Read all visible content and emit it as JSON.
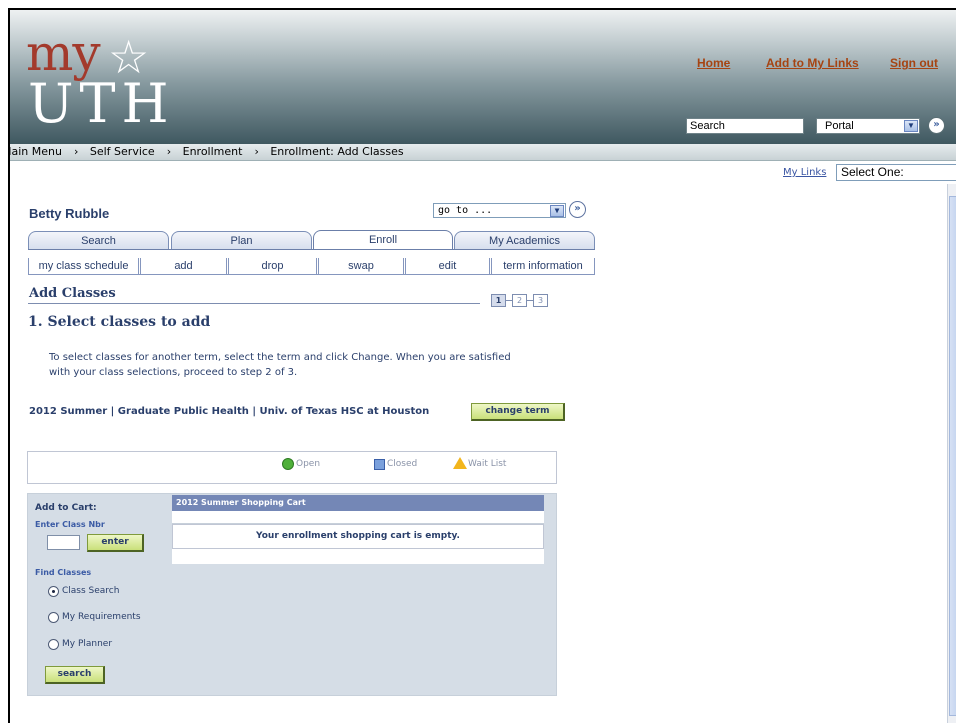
{
  "header": {
    "logo_my": "my",
    "logo_star": "☆",
    "logo_uth": "UTH",
    "links": [
      "Home",
      "Add to My Links",
      "Sign out"
    ],
    "search_value": "Search",
    "portal_value": "Portal"
  },
  "breadcrumb": [
    "Main Menu",
    "Self Service",
    "Enrollment",
    "Enrollment: Add Classes"
  ],
  "mylinks": {
    "label": "My Links",
    "select_value": "Select One:"
  },
  "student": {
    "name": "Betty Rubble",
    "goto": "go to ..."
  },
  "tabs": [
    "Search",
    "Plan",
    "Enroll",
    "My Academics"
  ],
  "subtabs": [
    "my class schedule",
    "add",
    "drop",
    "swap",
    "edit",
    "term information"
  ],
  "page": {
    "title": "Add Classes",
    "steps": [
      "1",
      "2",
      "3"
    ],
    "section_title": "1.  Select classes to add",
    "instructions": "To select classes for another term, select the term and click Change.  When you are satisfied with your class selections, proceed to step 2 of 3.",
    "term": "2012 Summer | Graduate Public Health | Univ. of Texas HSC at Houston",
    "change_term": "change term"
  },
  "legend": {
    "open": "Open",
    "closed": "Closed",
    "waitlist": "Wait List"
  },
  "add_to_cart": {
    "title": "Add to Cart:",
    "enter_nbr_label": "Enter Class Nbr",
    "enter_btn": "enter",
    "find_label": "Find Classes",
    "options": [
      "Class Search",
      "My Requirements",
      "My Planner"
    ],
    "selected": "Class Search",
    "search_btn": "search"
  },
  "cart": {
    "title": "2012 Summer Shopping Cart",
    "empty_msg": "Your enrollment shopping cart is empty."
  },
  "colors": {
    "brand_red": "#a33a2c",
    "link_orange": "#a64412",
    "nav_blue": "#2a3f6b",
    "button_green": "#c9e07a"
  }
}
